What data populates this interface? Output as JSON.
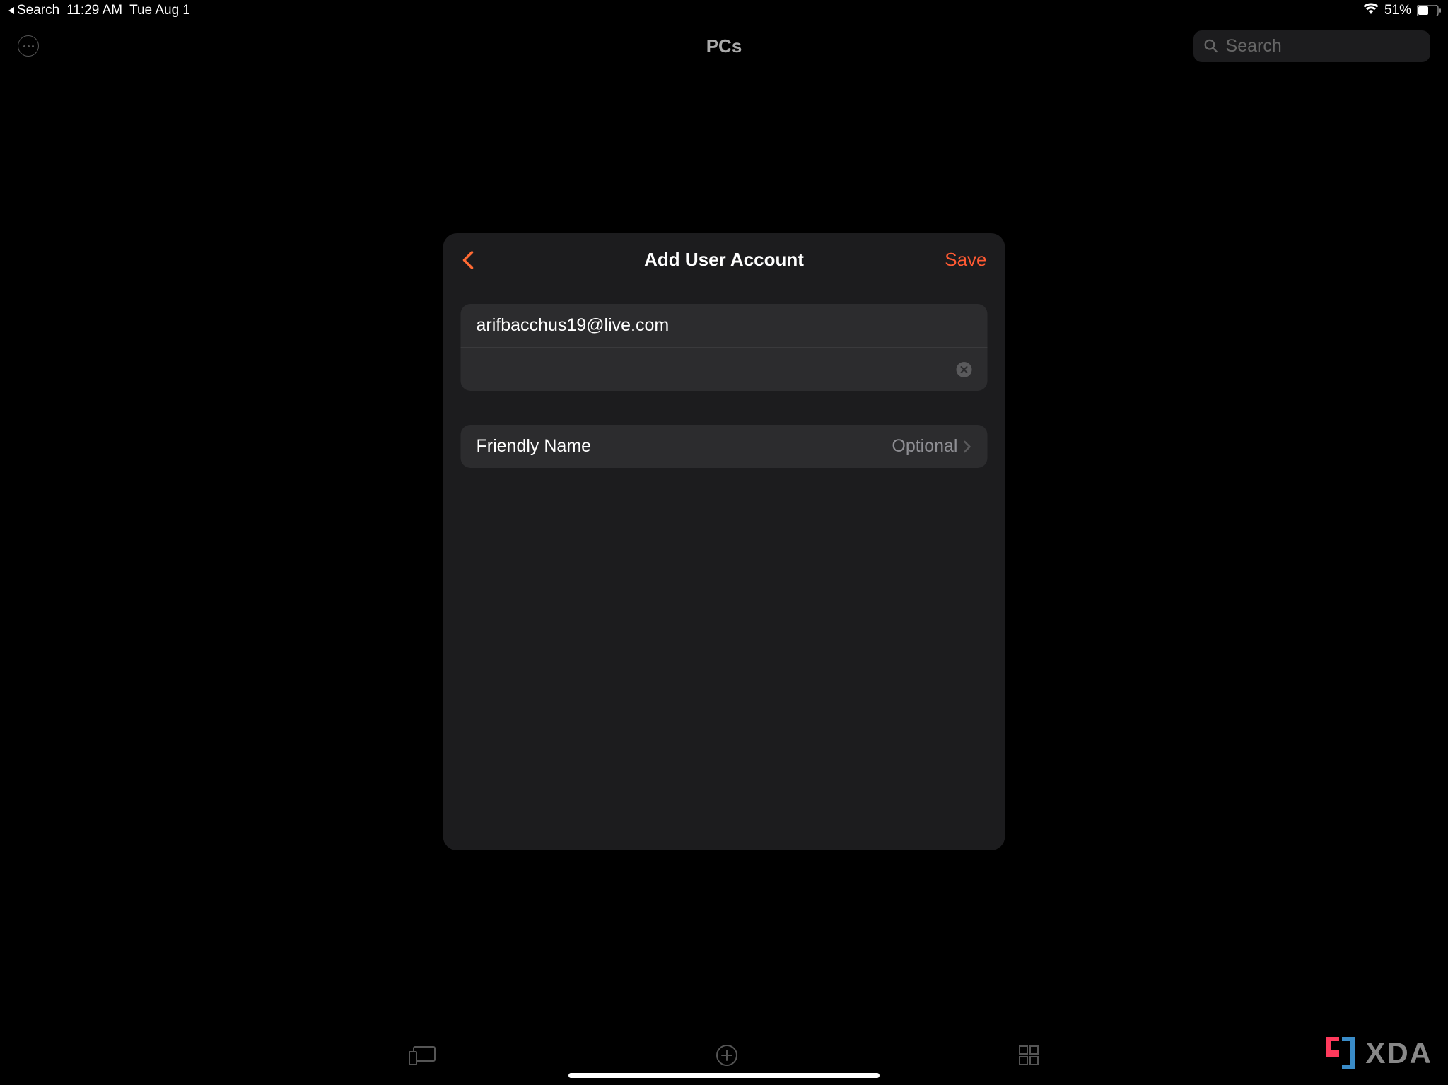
{
  "statusBar": {
    "backLabel": "Search",
    "time": "11:29 AM",
    "date": "Tue Aug 1",
    "battery": "51%"
  },
  "header": {
    "title": "PCs",
    "searchPlaceholder": "Search"
  },
  "modal": {
    "title": "Add User Account",
    "saveLabel": "Save",
    "usernameValue": "arifbacchus19@live.com",
    "passwordValue": "",
    "friendlyNameLabel": "Friendly Name",
    "friendlyNameValue": "Optional"
  },
  "watermark": {
    "text": "XDA"
  }
}
